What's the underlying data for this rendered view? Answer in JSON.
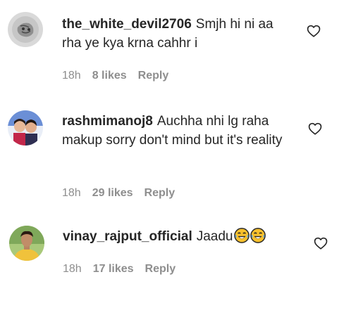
{
  "comments": [
    {
      "username": "the_white_devil2706",
      "text": "Smjh hi ni aa rha ye kya krna cahhr i",
      "time": "18h",
      "likes": "8 likes",
      "reply": "Reply",
      "avatar_icon": "avatar-sketch-icon"
    },
    {
      "username": "rashmimanoj8",
      "text": "Auchha nhi lg raha makup sorry don't mind but it's reality",
      "time": "18h",
      "likes": "29 likes",
      "reply": "Reply",
      "avatar_icon": "avatar-couple-icon"
    },
    {
      "username": "vinay_rajput_official",
      "text": "Jaadu",
      "emojis": [
        "joy-emoji",
        "joy-emoji"
      ],
      "time": "18h",
      "likes": "17 likes",
      "reply": "Reply",
      "avatar_icon": "avatar-person-yellow-icon"
    }
  ],
  "colors": {
    "text": "#262626",
    "meta": "#8e8e8e",
    "emoji": "#f7c02c"
  }
}
